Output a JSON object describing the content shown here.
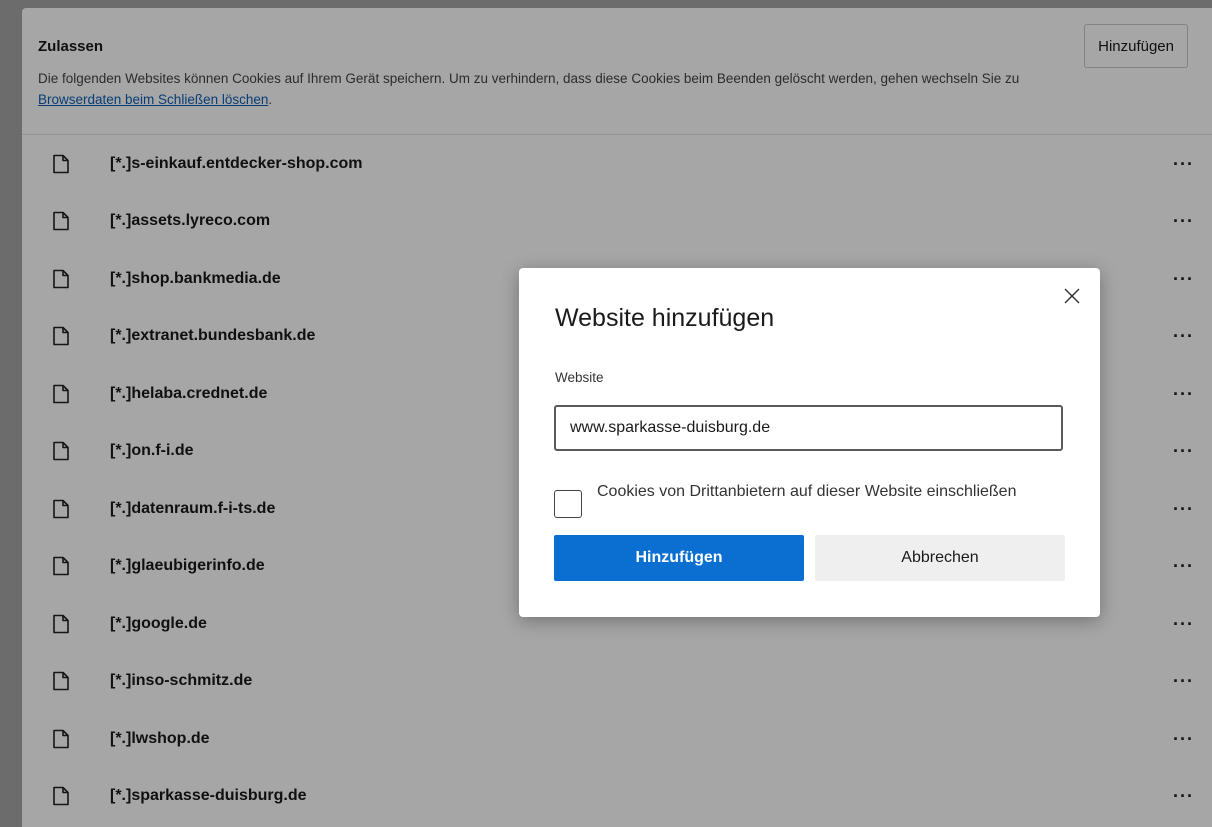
{
  "section": {
    "title": "Zulassen",
    "description_text": "Die folgenden Websites können Cookies auf Ihrem Gerät speichern. Um zu verhindern, dass diese Cookies beim Beenden gelöscht werden, gehen wechseln Sie zu ",
    "description_link": "Browserdaten beim Schließen löschen",
    "description_end": ".",
    "add_button_label": "Hinzufügen"
  },
  "sites": [
    {
      "label": "[*.]s-einkauf.entdecker-shop.com",
      "icon": "page-icon",
      "more": "···"
    },
    {
      "label": "[*.]assets.lyreco.com",
      "icon": "page-icon",
      "more": "···"
    },
    {
      "label": "[*.]shop.bankmedia.de",
      "icon": "page-icon",
      "more": "···"
    },
    {
      "label": "[*.]extranet.bundesbank.de",
      "icon": "page-icon",
      "more": "···"
    },
    {
      "label": "[*.]helaba.crednet.de",
      "icon": "page-icon",
      "more": "···"
    },
    {
      "label": "[*.]on.f-i.de",
      "icon": "page-icon",
      "more": "···"
    },
    {
      "label": "[*.]datenraum.f-i-ts.de",
      "icon": "page-icon",
      "more": "···"
    },
    {
      "label": "[*.]glaeubigerinfo.de",
      "icon": "page-icon",
      "more": "···"
    },
    {
      "label": "[*.]google.de",
      "icon": "page-icon",
      "more": "···"
    },
    {
      "label": "[*.]inso-schmitz.de",
      "icon": "page-icon",
      "more": "···"
    },
    {
      "label": "[*.]lwshop.de",
      "icon": "page-icon",
      "more": "···"
    },
    {
      "label": "[*.]sparkasse-duisburg.de",
      "icon": "page-icon",
      "more": "···"
    }
  ],
  "dialog": {
    "title": "Website hinzufügen",
    "field_label": "Website",
    "input_value": "www.sparkasse-duisburg.de",
    "checkbox_label": "Cookies von Drittanbietern auf dieser Website einschließen",
    "checkbox_checked": false,
    "primary_button": "Hinzufügen",
    "secondary_button": "Abbrechen",
    "close_icon": "close-icon"
  },
  "colors": {
    "accent": "#0a6fd0",
    "link": "#0b5fb5",
    "secondary_button_bg": "#efefef"
  }
}
